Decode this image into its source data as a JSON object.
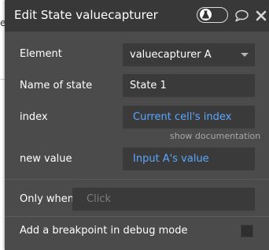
{
  "panel": {
    "title": "Edit State valuecapturer"
  },
  "fields": {
    "element": {
      "label": "Element",
      "value": "valuecapturer A"
    },
    "state_name": {
      "label": "Name of state",
      "value": "State 1"
    },
    "index": {
      "label": "index",
      "value": "Current cell's index"
    },
    "documentation_link": "show documentation",
    "new_value": {
      "label": "new value",
      "value": "Input A's value"
    }
  },
  "conditions": {
    "only_when": {
      "label": "Only when",
      "placeholder": "Click"
    },
    "breakpoint": {
      "label": "Add a breakpoint in debug mode",
      "checked": false
    }
  },
  "colors": {
    "panel_bg": "#4b4b4b",
    "header_bg": "#383838",
    "field_bg": "#3a3a3a",
    "dynamic_value": "#5aa7ff"
  },
  "icons": {
    "toggle": "flask-toggle-icon",
    "comment": "speech-bubble-icon",
    "close": "close-icon",
    "dropdown": "chevron-down-icon"
  }
}
